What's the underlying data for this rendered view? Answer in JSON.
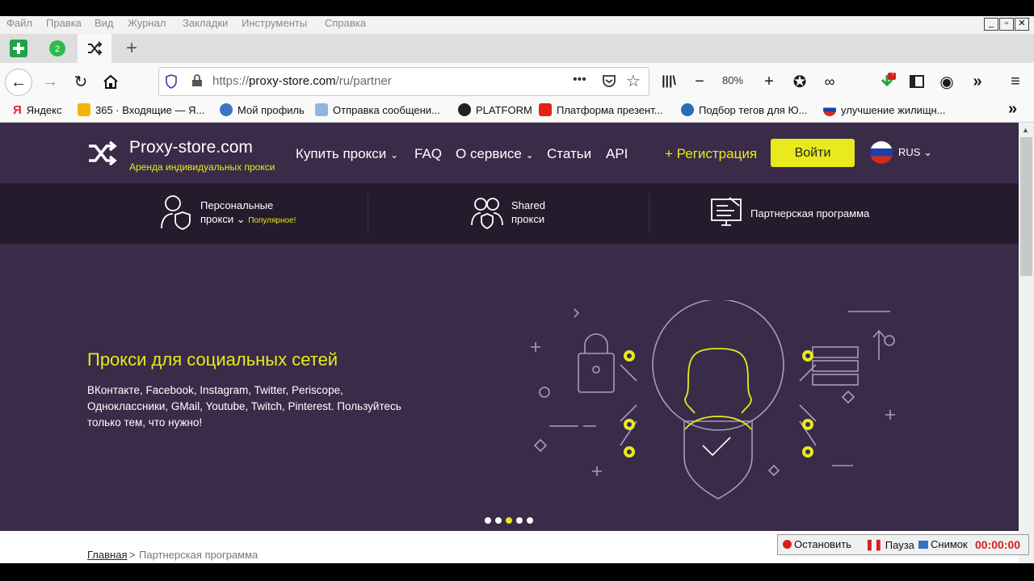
{
  "menubar": {
    "items": [
      "Файл",
      "Правка",
      "Вид",
      "Журнал",
      "Закладки",
      "Инструменты",
      "Справка"
    ]
  },
  "toolbar": {
    "url_prefix": "https://",
    "url_domain": "proxy-store.com",
    "url_path": "/ru/partner",
    "zoom": "80%",
    "download_badge": "?"
  },
  "bookmarks": [
    {
      "label": "Яндекс",
      "icon": "yandex-icon",
      "color": "#e6262b"
    },
    {
      "label": "365 · Входящие — Я...",
      "icon": "mail-icon",
      "color": "#f4b400"
    },
    {
      "label": "Мой профиль",
      "icon": "globe-icon",
      "color": "#3a74c8"
    },
    {
      "label": "Отправка сообщени...",
      "icon": "envelope-icon",
      "color": "#8fb5e0"
    },
    {
      "label": "PLATFORM",
      "icon": "web-icon",
      "color": "#222222"
    },
    {
      "label": "Платформа презент...",
      "icon": "youtube-icon",
      "color": "#e62117"
    },
    {
      "label": "Подбор тегов для Ю...",
      "icon": "bulb-icon",
      "color": "#2a6fb0"
    },
    {
      "label": "улучшение жилищн...",
      "icon": "russia-flag-icon",
      "color": "#d52b1e"
    }
  ],
  "site": {
    "logo_title": "Proxy-store.com",
    "logo_subtitle": "Аренда индивидуальных прокси",
    "nav": {
      "buy": "Купить прокси",
      "faq": "FAQ",
      "about": "О сервисе",
      "articles": "Статьи",
      "api": "API"
    },
    "register": "+ Регистрация",
    "login": "Войти",
    "lang": "RUS",
    "subnav": {
      "personal_line1": "Персональные",
      "personal_line2": "прокси",
      "popular": "Популярное!",
      "shared_line1": "Shared",
      "shared_line2": "прокси",
      "partner": "Партнерская программа"
    },
    "hero": {
      "title": "Прокси для социальных сетей",
      "text": "ВКонтакте, Facebook, Instagram, Twitter, Periscope, Одноклассники, GMail, Youtube, Twitch, Pinterest. Пользуйтесь только тем, что нужно!",
      "slides": 5,
      "active_slide": 3
    },
    "breadcrumb": {
      "home": "Главная",
      "separator": ">",
      "current": "Партнерская программа"
    }
  },
  "recorder": {
    "stop": "Остановить",
    "pause": "Пауза",
    "snapshot": "Снимок",
    "time": "00:00:00"
  },
  "colors": {
    "accent": "#e8ea1d",
    "page_bg": "#3a2b48",
    "subnav_bg": "#241b2d"
  }
}
